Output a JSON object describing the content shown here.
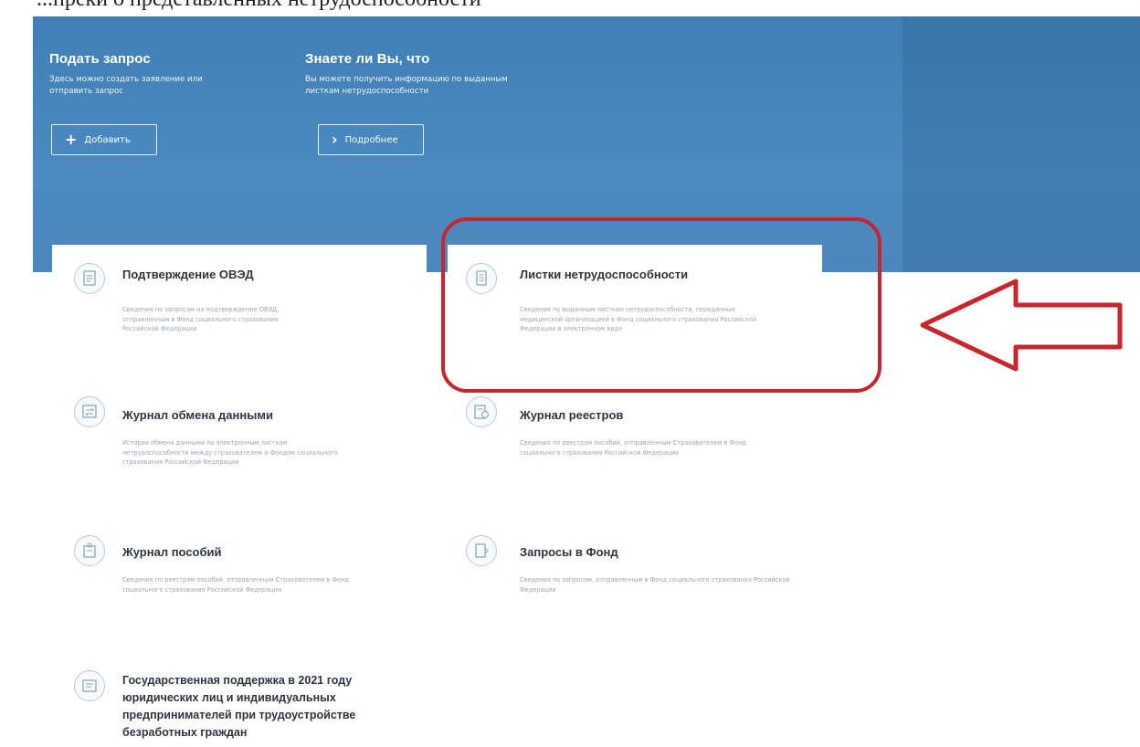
{
  "header": {
    "caption": "...преки о представленных нетрудоспособности"
  },
  "banner": {
    "request": {
      "title": "Подать запрос",
      "description": "Здесь можно создать заявление или отправить запрос",
      "button_label": "Добавить",
      "button_icon": "plus-icon"
    },
    "info": {
      "title": "Знаете ли Вы, что",
      "description": "Вы можете получить информацию по выданным листкам нетрудоспособности",
      "button_label": "Подробнее",
      "button_icon": "chevron-right-icon"
    }
  },
  "cards": [
    {
      "title": "Подтверждение ОВЭД",
      "description": "Сведения по запросам на подтверждение ОВЭД, отправленным в Фонд социального страхования Российской Федерации",
      "icon": "document-icon"
    },
    {
      "title": "Листки нетрудоспособности",
      "description": "Сведения по выданным листкам нетрудоспособности, переданные медицинской организацией в Фонд социального страхования Российской Федерации в электронном виде",
      "icon": "sick-leave-icon"
    },
    {
      "title": "Журнал обмена данными",
      "description": "История обмена данными по электронным листкам нетрудоспособности между страхователем и Фондом социального страхования Российской Федерации",
      "icon": "exchange-log-icon"
    },
    {
      "title": "Журнал реестров",
      "description": "Сведения по реестрам пособий, отправленным Страхователем в Фонд социального страхования Российской Федерации",
      "icon": "registry-log-icon"
    },
    {
      "title": "Журнал пособий",
      "description": "Сведения по реестрам пособий, отправленным Страхователем в Фонд социального страхования Российской Федерации",
      "icon": "benefits-log-icon"
    },
    {
      "title": "Запросы в Фонд",
      "description": "Сведения по запросам, отправленным в Фонд социального страхования Российской Федерации",
      "icon": "fund-request-icon"
    },
    {
      "title": "Государственная поддержка в 2021 году юридических лиц и индивидуальных предпринимателей при трудоустройстве безработных граждан",
      "description": "",
      "icon": "state-support-icon"
    }
  ],
  "annotation": {
    "highlight_color": "#c8262c",
    "arrow_color": "#c8262c"
  },
  "colors": {
    "banner": "#4a87bd",
    "title_text": "#2b3644",
    "desc_text": "#9aa6b2"
  }
}
